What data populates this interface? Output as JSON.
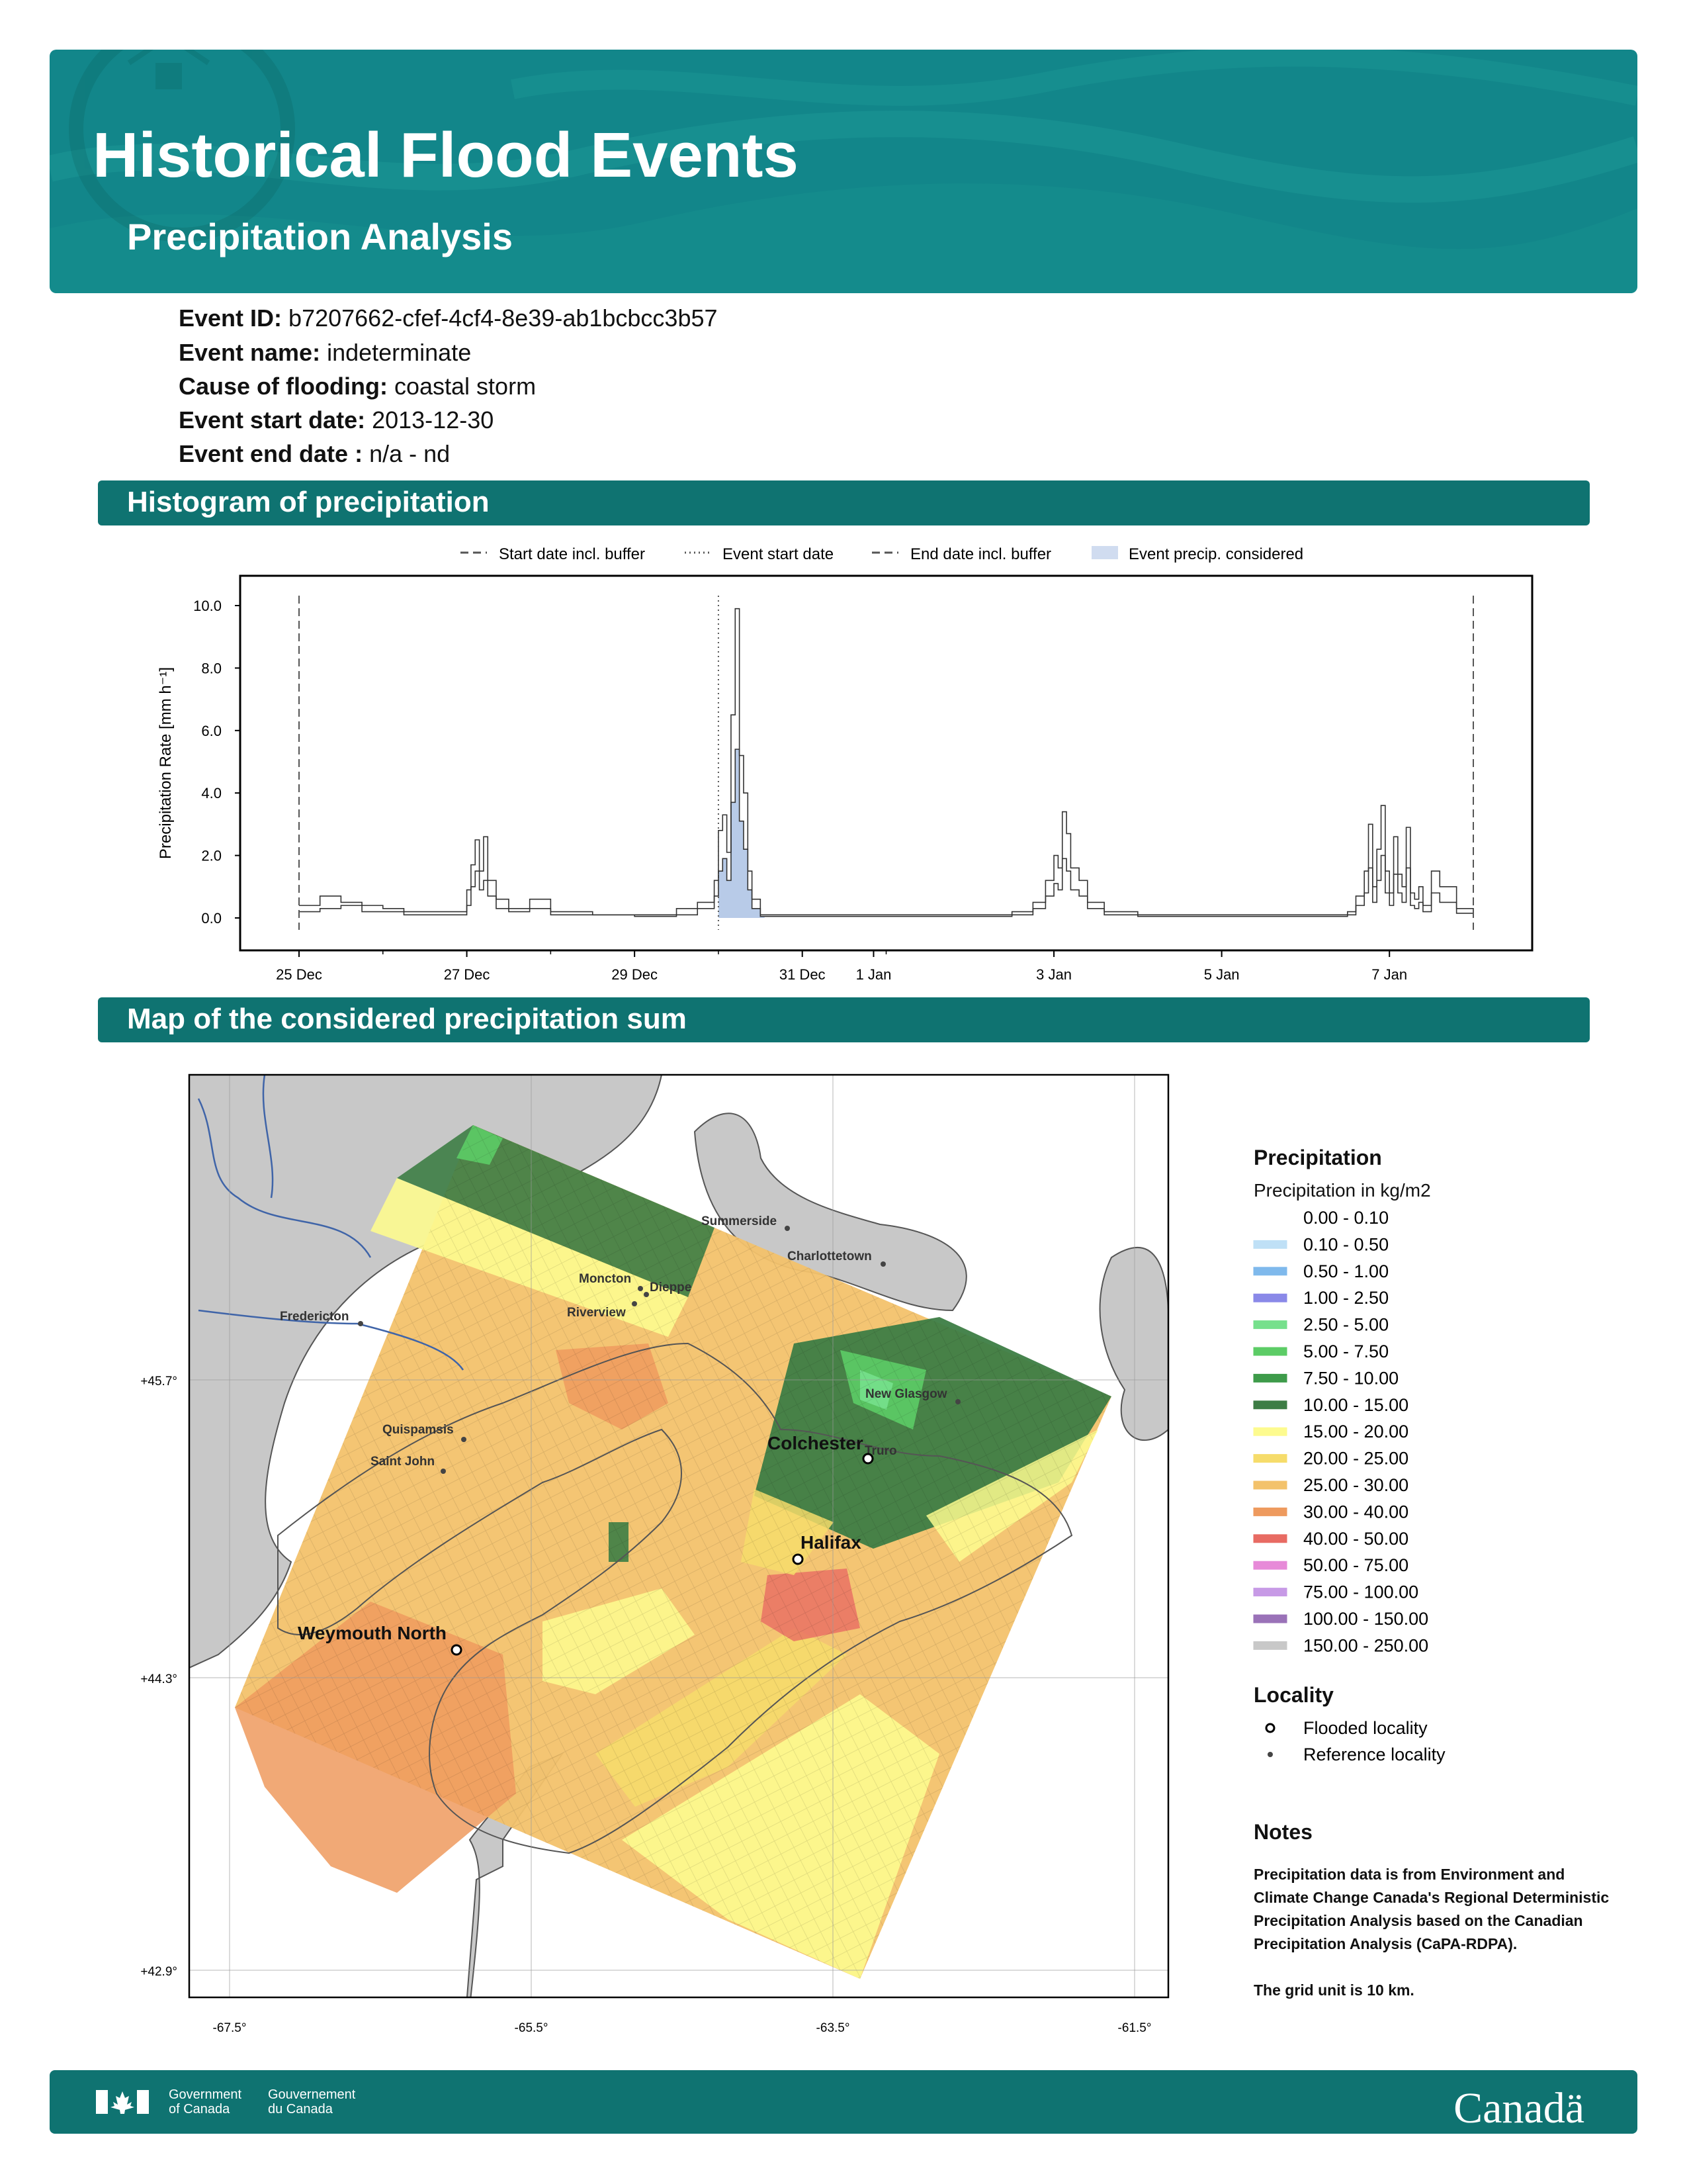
{
  "header": {
    "title": "Historical Flood Events",
    "subtitle": "Precipitation Analysis"
  },
  "event": {
    "id_label": "Event ID:",
    "id": "b7207662-cfef-4cf4-8e39-ab1bcbcc3b57",
    "name_label": "Event name:",
    "name": "indeterminate",
    "cause_label": "Cause of flooding:",
    "cause": "coastal storm",
    "start_label": "Event start date:",
    "start": "2013-12-30",
    "end_label": "Event end date :",
    "end": "n/a - nd"
  },
  "sections": {
    "histogram": "Histogram of precipitation",
    "map": "Map of the considered precipitation sum"
  },
  "chart_data": {
    "type": "line",
    "ylabel": "Precipitation Rate [mm h⁻¹]",
    "ylim": [
      0,
      10.5
    ],
    "y_ticks": [
      "0.0",
      "2.0",
      "4.0",
      "6.0",
      "8.0",
      "10.0"
    ],
    "x_ticks": [
      "25 Dec",
      "27 Dec",
      "29 Dec",
      "31 Dec",
      "1 Jan",
      "3 Jan",
      "5 Jan",
      "7 Jan"
    ],
    "legend": {
      "start_buffer": "Start date incl. buffer",
      "event_start": "Event start date",
      "end_buffer": "End date incl. buffer",
      "event_precip": "Event precip. considered"
    },
    "series": [
      {
        "x": [
          0,
          0.25,
          0.5,
          0.75,
          1.0,
          1.25,
          1.5,
          2.0,
          2.05,
          2.1,
          2.15,
          2.2,
          2.25,
          2.35,
          2.5,
          2.75,
          3.0,
          3.5,
          4.0,
          4.5,
          4.75,
          4.95,
          5.0,
          5.05,
          5.1,
          5.15,
          5.2,
          5.25,
          5.3,
          5.35,
          5.4,
          5.5,
          6.0,
          7.0,
          8.0,
          8.5,
          8.75,
          8.9,
          9.0,
          9.05,
          9.1,
          9.15,
          9.2,
          9.3,
          9.4,
          9.6,
          10.0,
          11.0,
          12.0,
          12.5,
          12.6,
          12.7,
          12.75,
          12.8,
          12.85,
          12.9,
          12.95,
          13.0,
          13.05,
          13.1,
          13.15,
          13.2,
          13.25,
          13.3,
          13.35,
          13.4,
          13.5,
          13.6,
          13.8,
          14.0
        ],
        "y": [
          0.4,
          0.7,
          0.5,
          0.4,
          0.3,
          0.2,
          0.2,
          0.9,
          1.7,
          2.5,
          1.5,
          2.6,
          1.2,
          0.6,
          0.3,
          0.6,
          0.2,
          0.1,
          0.1,
          0.3,
          0.5,
          1.2,
          2.8,
          3.3,
          2.1,
          6.5,
          9.9,
          5.2,
          4.0,
          1.5,
          0.6,
          0.1,
          0.1,
          0.1,
          0.1,
          0.2,
          0.5,
          1.2,
          2.0,
          1.6,
          3.4,
          2.7,
          1.6,
          1.2,
          0.5,
          0.2,
          0.1,
          0.1,
          0.1,
          0.2,
          0.7,
          1.5,
          3.0,
          1.0,
          2.2,
          3.6,
          1.5,
          0.8,
          2.6,
          1.4,
          1.0,
          2.9,
          0.8,
          0.6,
          1.0,
          0.4,
          1.5,
          1.0,
          0.3,
          0.2
        ]
      },
      {
        "x": [
          0,
          0.25,
          0.5,
          0.75,
          1.0,
          1.25,
          1.5,
          2.0,
          2.05,
          2.1,
          2.15,
          2.2,
          2.25,
          2.35,
          2.5,
          2.75,
          3.0,
          3.5,
          4.0,
          4.5,
          4.75,
          4.95,
          5.0,
          5.05,
          5.1,
          5.15,
          5.2,
          5.25,
          5.3,
          5.35,
          5.4,
          5.5,
          6.0,
          7.0,
          8.0,
          8.5,
          8.75,
          8.9,
          9.0,
          9.05,
          9.1,
          9.15,
          9.2,
          9.3,
          9.4,
          9.6,
          10.0,
          11.0,
          12.0,
          12.5,
          12.6,
          12.7,
          12.75,
          12.8,
          12.85,
          12.9,
          12.95,
          13.0,
          13.05,
          13.1,
          13.15,
          13.2,
          13.25,
          13.3,
          13.35,
          13.4,
          13.5,
          13.6,
          13.8,
          14.0
        ],
        "y": [
          0.2,
          0.3,
          0.4,
          0.2,
          0.2,
          0.1,
          0.1,
          0.4,
          1.0,
          1.5,
          0.9,
          1.2,
          0.7,
          0.3,
          0.2,
          0.3,
          0.1,
          0.1,
          0.05,
          0.1,
          0.3,
          0.7,
          1.5,
          1.9,
          1.2,
          3.7,
          5.4,
          3.1,
          2.2,
          0.9,
          0.3,
          0.05,
          0.05,
          0.05,
          0.05,
          0.1,
          0.3,
          0.7,
          1.1,
          0.9,
          1.9,
          1.5,
          0.9,
          0.7,
          0.3,
          0.1,
          0.05,
          0.05,
          0.05,
          0.1,
          0.4,
          0.8,
          1.6,
          0.5,
          1.2,
          2.0,
          0.8,
          0.4,
          1.4,
          0.8,
          0.5,
          1.6,
          0.4,
          0.3,
          0.5,
          0.2,
          0.8,
          0.5,
          0.15,
          0.1
        ]
      }
    ],
    "event_precip": {
      "x": [
        5.0,
        5.05,
        5.1,
        5.15,
        5.2,
        5.25,
        5.3,
        5.35,
        5.4,
        5.5
      ],
      "y": [
        1.5,
        1.9,
        1.2,
        3.7,
        5.4,
        3.1,
        2.2,
        0.9,
        0.3,
        0.05
      ]
    }
  },
  "map": {
    "lat_labels": [
      "+45.7°",
      "+44.3°",
      "+42.9°"
    ],
    "lon_labels": [
      "-67.5°",
      "-65.5°",
      "-63.5°",
      "-61.5°"
    ],
    "flooded": [
      {
        "name": "Colchester"
      },
      {
        "name": "Halifax"
      },
      {
        "name": "Weymouth North"
      }
    ],
    "reference": [
      {
        "name": "Summerside"
      },
      {
        "name": "Charlottetown"
      },
      {
        "name": "Moncton"
      },
      {
        "name": "Dieppe"
      },
      {
        "name": "Riverview"
      },
      {
        "name": "Fredericton"
      },
      {
        "name": "New Glasgow"
      },
      {
        "name": "Quispamsis"
      },
      {
        "name": "Saint John"
      },
      {
        "name": "Truro"
      }
    ]
  },
  "precip_legend": {
    "title": "Precipitation",
    "subtitle": "Precipitation in kg/m2",
    "items": [
      {
        "label": "0.00 - 0.10",
        "color": "#ffffff"
      },
      {
        "label": "0.10 - 0.50",
        "color": "#bfe0f6"
      },
      {
        "label": "0.50 - 1.00",
        "color": "#7fb9ec"
      },
      {
        "label": "1.00 - 2.50",
        "color": "#8a89e8"
      },
      {
        "label": "2.50 - 5.00",
        "color": "#76e08c"
      },
      {
        "label": "5.00 - 7.50",
        "color": "#5ccc66"
      },
      {
        "label": "7.50 - 10.00",
        "color": "#3e9b4a"
      },
      {
        "label": "10.00 - 15.00",
        "color": "#3d7d45"
      },
      {
        "label": "15.00 - 20.00",
        "color": "#fdfb8f"
      },
      {
        "label": "20.00 - 25.00",
        "color": "#f6dc6b"
      },
      {
        "label": "25.00 - 30.00",
        "color": "#f3c26b"
      },
      {
        "label": "30.00 - 40.00",
        "color": "#ee9a5e"
      },
      {
        "label": "40.00 - 50.00",
        "color": "#e86b63"
      },
      {
        "label": "50.00 - 75.00",
        "color": "#e78ad8"
      },
      {
        "label": "75.00 - 100.00",
        "color": "#c79ae6"
      },
      {
        "label": "100.00 - 150.00",
        "color": "#9a72b8"
      },
      {
        "label": "150.00 - 250.00",
        "color": "#c8c8c8"
      }
    ]
  },
  "locality_legend": {
    "title": "Locality",
    "flooded": "Flooded locality",
    "reference": "Reference locality"
  },
  "notes": {
    "title": "Notes",
    "text1": "Precipitation data is from Environment and Climate Change Canada's Regional Deterministic Precipitation Analysis based on the Canadian Precipitation Analysis (CaPA-RDPA).",
    "text2": "The grid unit is 10 km."
  },
  "footer": {
    "en_line1": "Government",
    "en_line2": "of Canada",
    "fr_line1": "Gouvernement",
    "fr_line2": "du Canada",
    "wordmark": "Canadä"
  },
  "colors": {
    "banner": "#12868a",
    "section": "#0f7371",
    "event_fill": "#b8cbe8"
  }
}
